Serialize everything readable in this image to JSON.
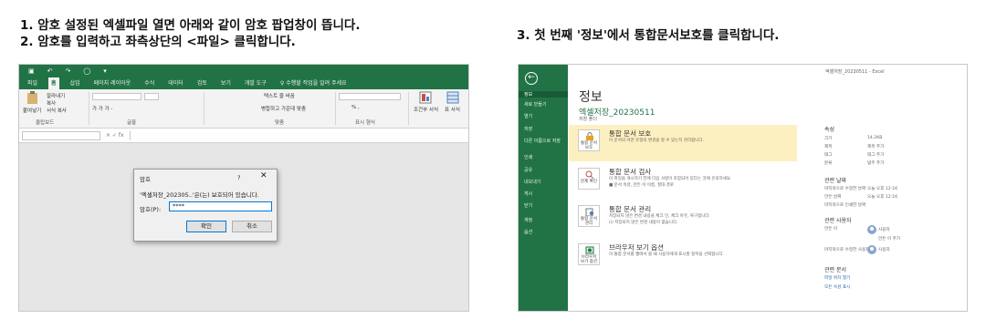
{
  "captions": {
    "left_line1": "1. 암호 설정된 엑셀파일 열면 아래와 같이 암호 팝업창이 뜹니다.",
    "left_line2": "2. 암호를 입력하고 좌측상단의 <파일> 클릭합니다.",
    "right": "3. 첫 번째 '정보'에서 통합문서보호를 클릭합니다."
  },
  "excel": {
    "tabs": [
      "파일",
      "홈",
      "삽입",
      "페이지 레이아웃",
      "수식",
      "데이터",
      "검토",
      "보기",
      "개발 도구",
      "♀ 수행할 작업을 알려 주세요"
    ],
    "active_tab": "홈",
    "ribbon": {
      "paste": "붙여넣기",
      "cut": "잘라내기",
      "copy": "복사",
      "format_painter": "서식 복사",
      "font_style": "가 가 가 -",
      "wrap_text": "텍스트 줄 바꿈",
      "merge_center": "병합하고 가운데 맞춤",
      "number_format": "% ,",
      "conditional": "조건부 서식",
      "table_format": "표 서식",
      "group_clipboard": "클립보드",
      "group_font": "글꼴",
      "group_align": "맞춤",
      "group_number": "표시 형식"
    },
    "formula_icons": "× ✓ fx",
    "dialog": {
      "title": "암호",
      "help": "?",
      "close": "✕",
      "message": "'엑셀저장_202305..'은(는) 보호되어 있습니다.",
      "password_label": "암호(P):",
      "password_value": "****",
      "ok": "확인",
      "cancel": "취소"
    }
  },
  "backstage": {
    "file_name": "엑셀저장_20230511 - Excel",
    "sidebar": [
      "정보",
      "새로 만들기",
      "열기",
      "저장",
      "다른 이름으로 저장",
      "인쇄",
      "공유",
      "내보내기",
      "게시",
      "닫기",
      "계정",
      "옵션"
    ],
    "active_item": "정보",
    "heading": "정보",
    "doc_name": "엑셀저장_20230511",
    "doc_path": "저장 폴더",
    "options": [
      {
        "title": "통합 문서 보호",
        "icon_label": "통합 문서 보호",
        "desc": "이 문서의 어떤 유형의 변경을 할 수 있는지 관리합니다.",
        "desc2": ""
      },
      {
        "title": "통합 문서 검사",
        "icon_label": "문제 확인",
        "desc": "이 파일을 게시하기 전에 다음 사항이 포함되어 있다는 것에 유의하세요.",
        "desc2": "■ 문서 속성, 만든 이 이름, 절대 경로"
      },
      {
        "title": "통합 문서 관리",
        "icon_label": "통합 문서 관리",
        "desc": "저장되지 않은 변경 내용을 체크 인, 체크 아웃, 복구합니다.",
        "desc2": "(i) 저장되지 않은 변경 내용이 없습니다."
      },
      {
        "title": "브라우저 보기 옵션",
        "icon_label": "브라우저 보기 옵션",
        "desc": "이 통합 문서를 웹에서 볼 때 사용자에게 표시할 항목을 선택합니다.",
        "desc2": ""
      }
    ],
    "properties": {
      "heading": "속성",
      "rows": [
        {
          "key": "크기",
          "value": "14.2KB"
        },
        {
          "key": "제목",
          "value": "제목 추가"
        },
        {
          "key": "태그",
          "value": "태그 추가"
        },
        {
          "key": "분류",
          "value": "범주 추가"
        }
      ],
      "dates_heading": "관련 날짜",
      "dates": [
        {
          "key": "마지막으로 수정한 날짜",
          "value": "오늘 오후 12:16"
        },
        {
          "key": "만든 날짜",
          "value": "오늘 오후 12:16"
        },
        {
          "key": "마지막으로 인쇄한 날짜",
          "value": ""
        }
      ],
      "people_heading": "관련 사용자",
      "author_key": "만든 이",
      "author": "사용자",
      "add_author": "만든 이 추가",
      "modified_by_key": "마지막으로 수정한 사용자",
      "modified_by": "사용자",
      "docs_heading": "관련 문서",
      "open_location": "파일 위치 열기",
      "show_all": "모든 속성 표시"
    }
  }
}
